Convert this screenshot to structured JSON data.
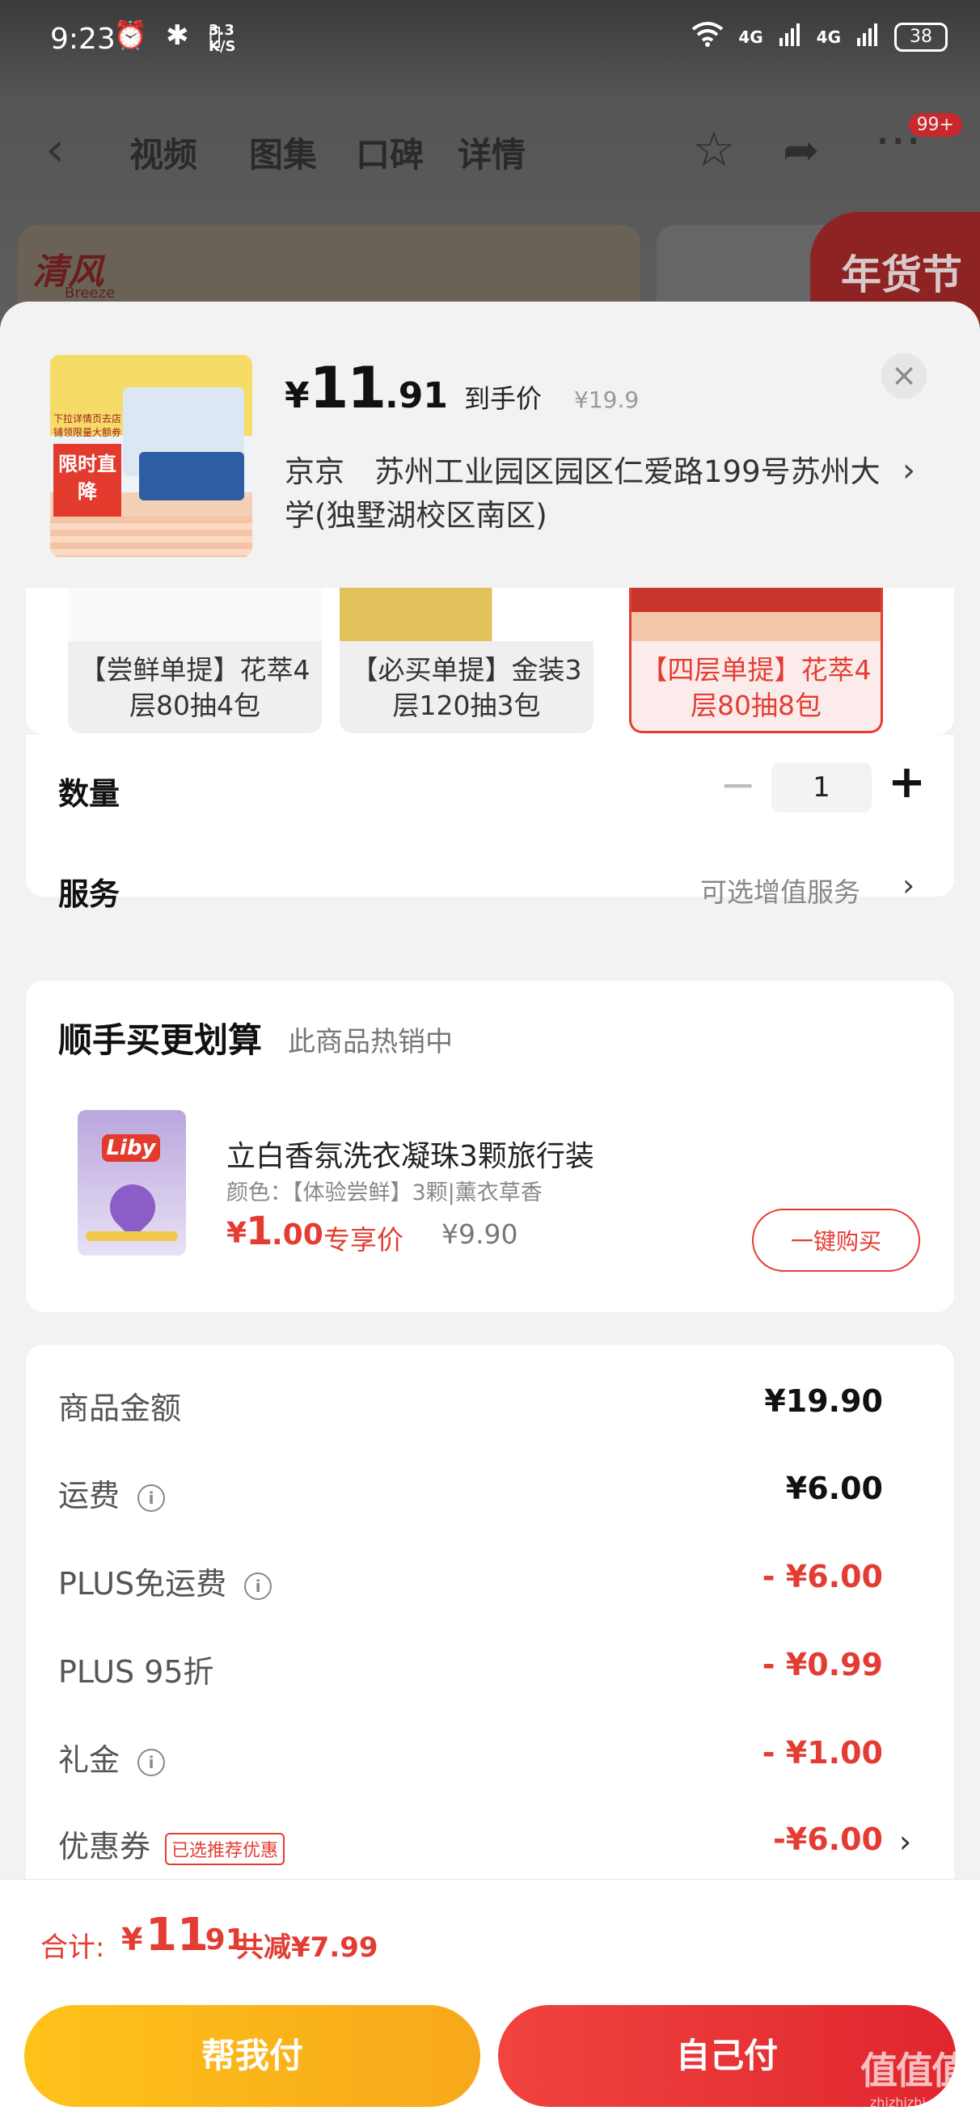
{
  "status_bar": {
    "time": "9:23",
    "left_icons": "⏰ ✱ ▯",
    "net_speed_top": "3.3",
    "net_speed_bottom": "K/S",
    "signal_1": "4G",
    "signal_2": "4G",
    "battery": "38"
  },
  "nav": {
    "tabs": [
      "视频",
      "图集",
      "口碑",
      "详情"
    ],
    "badge": "99+"
  },
  "background": {
    "brand_logo": "清风",
    "brand_sub": "Breeze",
    "promo": "年货节"
  },
  "sheet": {
    "header": {
      "price_yen": "¥",
      "price_int": "11",
      "price_dec": ".91",
      "price_label": "到手价",
      "original_price": "¥19.9",
      "address": "京京　苏州工业园区园区仁爱路199号苏州大学(独墅湖校区南区)",
      "thumb_tag": "限时直降",
      "thumb_note": "下拉详情页去店铺领限量大额券"
    },
    "variants": [
      {
        "label": "【尝鲜单提】花萃4层80抽4包",
        "selected": false
      },
      {
        "label": "【必买单提】金装3层120抽3包",
        "selected": false
      },
      {
        "label": "【四层单提】花萃4层80抽8包",
        "selected": true
      }
    ],
    "quantity": {
      "label": "数量",
      "minus": "−",
      "value": "1",
      "plus": "+"
    },
    "service": {
      "label": "服务",
      "value": "可选增值服务"
    },
    "upsell": {
      "title": "顺手买更划算",
      "subtitle": "此商品热销中",
      "product_name": "立白香氛洗衣凝珠3颗旅行装",
      "spec": "颜色：【体验尝鲜】3颗|薰衣草香",
      "price_yen": "¥",
      "price_int": "1",
      "price_dec": ".00",
      "price_label": "专享价",
      "original_price": "¥9.90",
      "buy_button": "一键购买",
      "img_brand": "Liby"
    },
    "fees": [
      {
        "label": "商品金额",
        "value": "¥19.90",
        "info": false,
        "red": false
      },
      {
        "label": "运费",
        "value": "¥6.00",
        "info": true,
        "red": false
      },
      {
        "label": "PLUS免运费",
        "value": "- ¥6.00",
        "info": true,
        "red": true
      },
      {
        "label": "PLUS 95折",
        "value": "- ¥0.99",
        "info": false,
        "red": true
      },
      {
        "label": "礼金",
        "value": "- ¥1.00",
        "info": true,
        "red": true
      },
      {
        "label": "优惠券",
        "value": "-¥6.00",
        "info": false,
        "red": true,
        "tag": "已选推荐优惠"
      }
    ]
  },
  "bottom": {
    "total_label": "合计:",
    "total_yen": "¥",
    "total_int": "11",
    "total_dec": ".91",
    "total_saving": "共减¥7.99",
    "friend_pay": "帮我付",
    "self_pay": "自己付",
    "watermark": "值值值",
    "watermark_url": "zhizhizhi.com"
  },
  "colors": {
    "accent_red": "#e33d33",
    "friend_pay_yellow": "#ffc21a",
    "self_pay_red": "#e0262e"
  }
}
